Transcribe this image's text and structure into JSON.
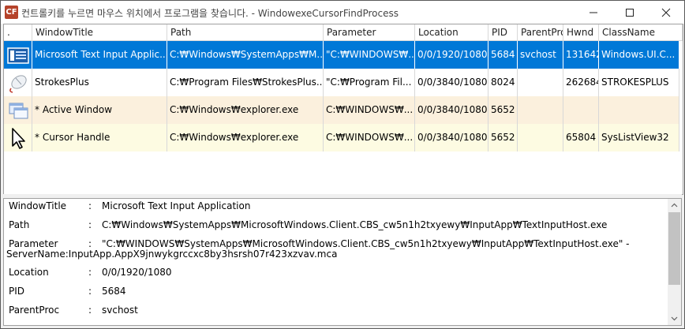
{
  "window": {
    "app_icon_text": "CF",
    "title": "컨트롤키를 누르면 마우스 위치에서 프로그램을 찾습니다. - WindowexeCursorFindProcess"
  },
  "table": {
    "columns": [
      ".",
      "WindowTitle",
      "Path",
      "Parameter",
      "Location",
      "PID",
      "ParentProc",
      "Hwnd",
      "ClassName"
    ],
    "rows": [
      {
        "icon": "text-input-window-icon",
        "title": "Microsoft Text Input Applic...",
        "path": "C:₩Windows₩SystemApps₩M...",
        "parameter": "\"C:₩WINDOWS₩...",
        "location": "0/0/1920/1080",
        "pid": "5684",
        "parent": "svchost",
        "hwnd": "131642",
        "class": "Windows.UI.C...",
        "state": "selected"
      },
      {
        "icon": "strokesplus-mouse-icon",
        "title": "StrokesPlus",
        "path": "C:₩Program Files₩StrokesPlus...",
        "parameter": "\"C:₩Program Fil...",
        "location": "0/0/3840/1080",
        "pid": "8024",
        "parent": "",
        "hwnd": "262684",
        "class": "STROKESPLUS",
        "state": "normal"
      },
      {
        "icon": "active-window-icon",
        "title": "* Active Window",
        "path": "C:₩Windows₩explorer.exe",
        "parameter": "C:₩WINDOWS₩...",
        "location": "0/0/3840/1080",
        "pid": "5652",
        "parent": "",
        "hwnd": "",
        "class": "",
        "state": "active"
      },
      {
        "icon": "cursor-arrow-icon",
        "title": "* Cursor Handle",
        "path": "C:₩Windows₩explorer.exe",
        "parameter": "C:₩WINDOWS₩...",
        "location": "0/0/3840/1080",
        "pid": "5652",
        "parent": "",
        "hwnd": "65804",
        "class": "SysListView32",
        "state": "cursor"
      }
    ]
  },
  "detail": {
    "window_title_key": "WindowTitle",
    "window_title_val": "Microsoft Text Input Application",
    "path_key": "Path",
    "path_val": "C:₩Windows₩SystemApps₩MicrosoftWindows.Client.CBS_cw5n1h2txyewy₩InputApp₩TextInputHost.exe",
    "parameter_key": "Parameter",
    "parameter_val": "\"C:₩WINDOWS₩SystemApps₩MicrosoftWindows.Client.CBS_cw5n1h2txyewy₩InputApp₩TextInputHost.exe\" -",
    "parameter_cont": "ServerName:InputApp.AppX9jnwykgrccxc8by3hsrsh07r423xzvav.mca",
    "location_key": "Location",
    "location_val": "0/0/1920/1080",
    "pid_key": "PID",
    "pid_val": "5684",
    "parent_key": "ParentProc",
    "parent_val": "svchost",
    "colon": ":"
  },
  "colors": {
    "selected_bg": "#0078d7",
    "active_bg": "#fbf0dd",
    "cursor_bg": "#fdfbe2",
    "app_icon_bg": "#b5432a"
  }
}
